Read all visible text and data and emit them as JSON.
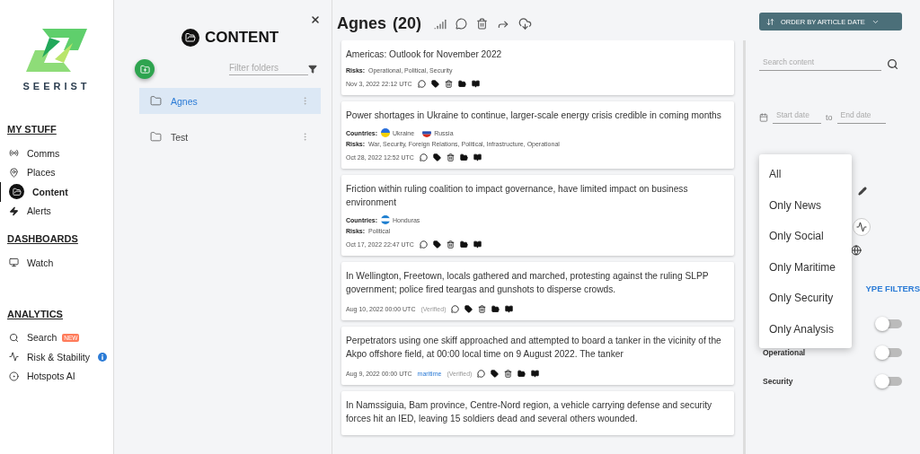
{
  "nav": {
    "brand": "SEERIST",
    "sections": [
      {
        "title": "MY STUFF",
        "items": [
          {
            "label": "Comms",
            "selected": false
          },
          {
            "label": "Places",
            "selected": false
          },
          {
            "label": "Content",
            "selected": true
          },
          {
            "label": "Alerts",
            "selected": false
          }
        ]
      },
      {
        "title": "DASHBOARDS",
        "items": [
          {
            "label": "Watch",
            "selected": false
          }
        ]
      },
      {
        "title": "ANALYTICS",
        "items": [
          {
            "label": "Search",
            "selected": false,
            "badge": "NEW"
          },
          {
            "label": "Risk & Stability",
            "selected": false,
            "info": true
          },
          {
            "label": "Hotspots AI",
            "selected": false
          }
        ]
      }
    ]
  },
  "folders": {
    "title": "CONTENT",
    "filter": {
      "placeholder": "Filter folders"
    },
    "items": [
      {
        "name": "Agnes",
        "selected": true
      },
      {
        "name": "Test",
        "selected": false
      }
    ]
  },
  "main": {
    "title": "Agnes",
    "count": "(20)",
    "articles": [
      {
        "title": "Americas: Outlook for November 2022",
        "risks_label": "Risks:",
        "risks": "Operational, Political, Security",
        "date": "Nov 3, 2022 22:12 UTC"
      },
      {
        "title": "Power shortages in Ukraine to continue, larger-scale energy crisis credible in coming months",
        "countries_label": "Countries:",
        "countries": [
          {
            "name": "Ukraine"
          },
          {
            "name": "Russia"
          }
        ],
        "risks_label": "Risks:",
        "risks": "War, Security, Foreign Relations, Political, Infrastructure, Operational",
        "date": "Oct 28, 2022 12:52 UTC"
      },
      {
        "title": "Friction within ruling coalition to impact governance, have limited impact on business environment",
        "countries_label": "Countries:",
        "countries": [
          {
            "name": "Honduras"
          }
        ],
        "risks_label": "Risks:",
        "risks": "Political",
        "date": "Oct 17, 2022 22:47 UTC"
      },
      {
        "title": "In Wellington, Freetown, locals gathered and marched, protesting against the ruling SLPP government; police fired teargas and gunshots to disperse crowds.",
        "date": "Aug 10, 2022 00:00 UTC",
        "status": "(Verified)"
      },
      {
        "title": "Perpetrators using one skiff approached and attempted to board a tanker in the vicinity of the Akpo offshore field, at 00:00 local time on 9 August 2022. The tanker",
        "date": "Aug 9, 2022 00:00 UTC",
        "source": "maritime",
        "status": "(Verified)"
      },
      {
        "title": "In Namssiguia, Bam province, Centre-Nord region, a vehicle carrying defense and security forces hit an IED, leaving 15 soldiers dead and several others wounded."
      }
    ]
  },
  "side": {
    "order_button": "ORDER BY ARTICLE DATE",
    "search": {
      "placeholder": "Search content"
    },
    "start_date": {
      "placeholder": "Start date"
    },
    "to": "to",
    "end_date": {
      "placeholder": "End date"
    },
    "filter_heading": "YPE FILTERS",
    "toggles": [
      {
        "on": false
      },
      {
        "label": "Operational",
        "on": false
      },
      {
        "label": "Security",
        "on": false
      }
    ],
    "menu": [
      "All",
      "Only News",
      "Only Social",
      "Only Maritime",
      "Only Security",
      "Only Analysis"
    ]
  }
}
